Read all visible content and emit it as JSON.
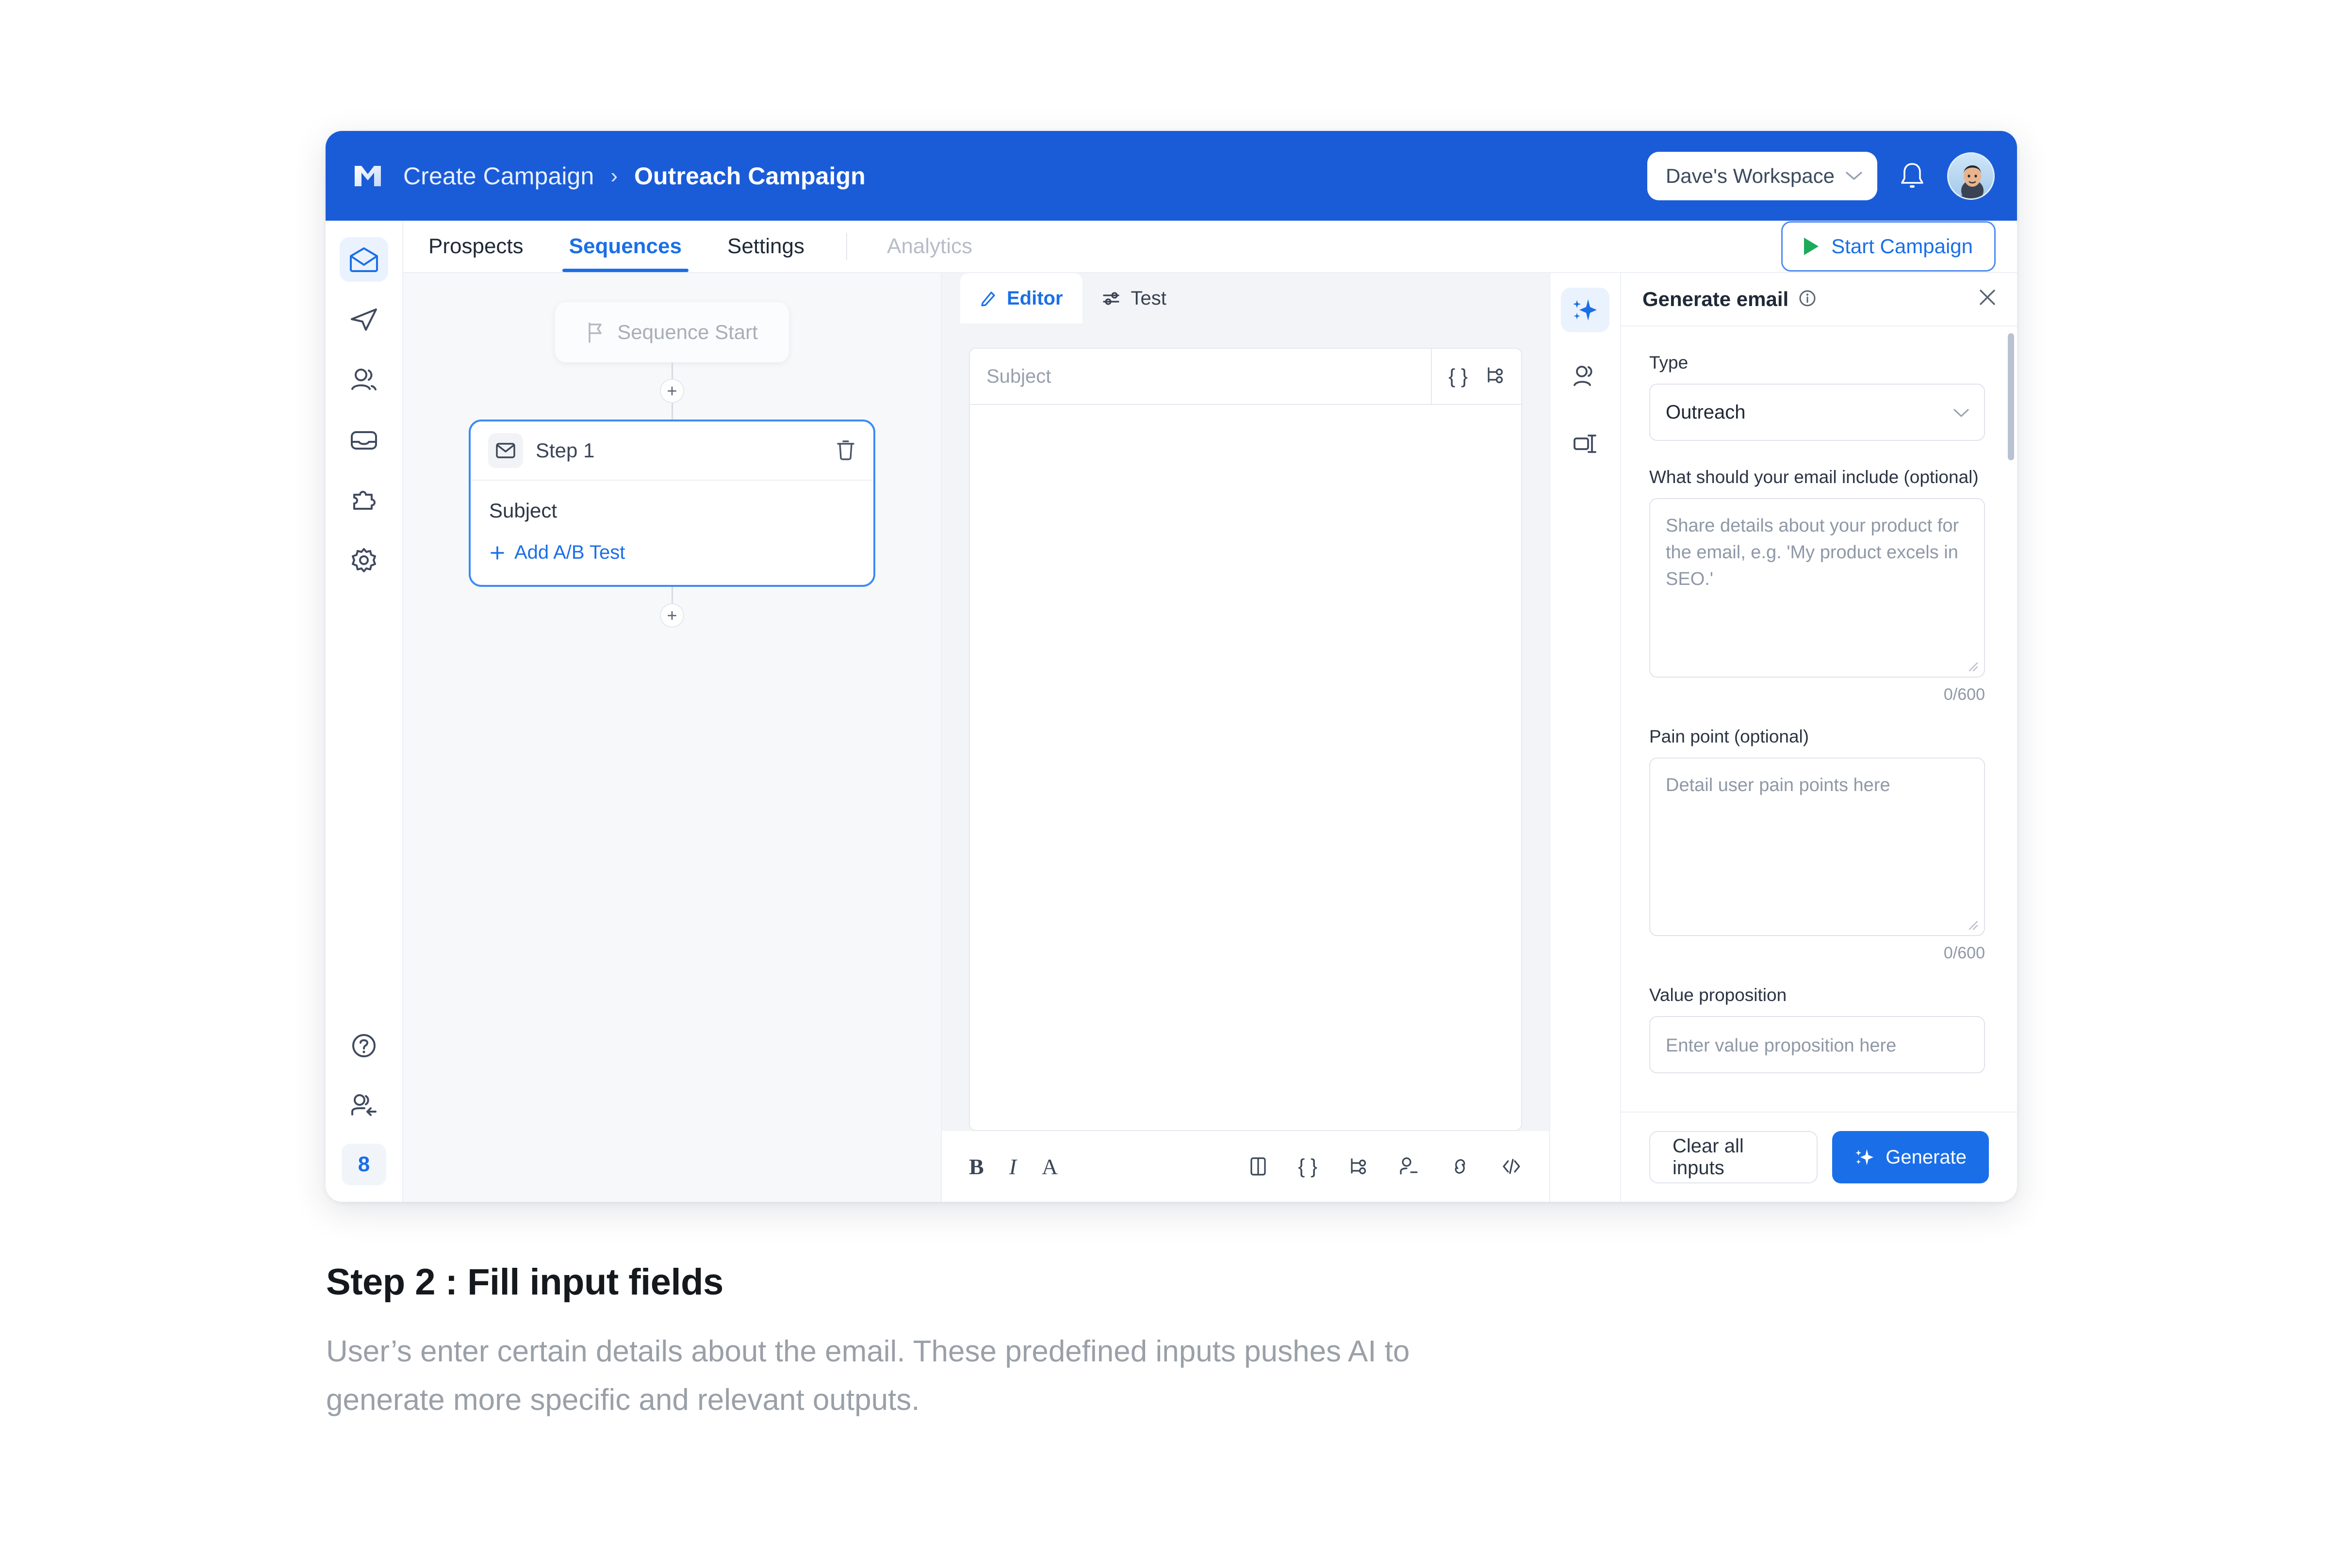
{
  "topbar": {
    "logo_icon": "logo-m-icon",
    "breadcrumb_parent": "Create Campaign",
    "breadcrumb_separator": "›",
    "breadcrumb_current": "Outreach Campaign",
    "workspace": "Dave's Workspace",
    "workspace_caret_icon": "chevron-down-icon",
    "bell_icon": "notification-bell-icon",
    "avatar_icon": "user-avatar",
    "bar_color": "#1a5cd8"
  },
  "rail": {
    "items": [
      {
        "name": "mail",
        "icon": "mail-open-icon",
        "active": true
      },
      {
        "name": "send",
        "icon": "paper-plane-icon",
        "active": false
      },
      {
        "name": "prospects",
        "icon": "people-icon",
        "active": false
      },
      {
        "name": "inbox",
        "icon": "inbox-icon",
        "active": false
      },
      {
        "name": "integrations",
        "icon": "puzzle-icon",
        "active": false
      },
      {
        "name": "settings",
        "icon": "gear-icon",
        "active": false
      }
    ],
    "bottom": [
      {
        "name": "help",
        "icon": "help-circle-icon"
      },
      {
        "name": "invite",
        "icon": "user-arrow-icon"
      }
    ],
    "badge": "8",
    "badge_color": "#1a6fe8"
  },
  "tabs": {
    "items": [
      {
        "label": "Prospects",
        "active": false,
        "disabled": false
      },
      {
        "label": "Sequences",
        "active": true,
        "disabled": false
      },
      {
        "label": "Settings",
        "active": false,
        "disabled": false
      },
      {
        "label": "Analytics",
        "active": false,
        "disabled": true
      }
    ],
    "start_button": "Start Campaign",
    "start_icon": "play-triangle-icon",
    "accent": "#1a6fe8",
    "play_color": "#1cab5b"
  },
  "canvas": {
    "sequence_start": "Sequence Start",
    "sequence_start_icon": "flag-icon",
    "step": {
      "title": "Step 1",
      "icon": "mail-closed-icon",
      "delete_icon": "trash-icon",
      "subject": "Subject",
      "ab_test": "Add A/B Test",
      "ab_icon": "plus-icon",
      "border_color": "#3d8bf2"
    },
    "add_icon": "plus-icon"
  },
  "editor": {
    "tabs": [
      {
        "label": "Editor",
        "icon": "pencil-icon",
        "active": true
      },
      {
        "label": "Test",
        "icon": "sliders-icon",
        "active": false
      }
    ],
    "subject_placeholder": "Subject",
    "subject_tools": [
      {
        "name": "variable",
        "icon": "curly-braces-icon",
        "glyph": "{ }"
      },
      {
        "name": "branch",
        "icon": "branch-icon"
      }
    ],
    "toolbar_left": [
      {
        "name": "bold",
        "icon": "bold-icon",
        "glyph": "B"
      },
      {
        "name": "italic",
        "icon": "italic-icon",
        "glyph": "I"
      },
      {
        "name": "text-style",
        "icon": "font-icon",
        "glyph": "A"
      }
    ],
    "toolbar_right": [
      {
        "name": "layout",
        "icon": "columns-icon"
      },
      {
        "name": "variable",
        "icon": "curly-braces-icon",
        "glyph": "{ }"
      },
      {
        "name": "branch",
        "icon": "branch-icon"
      },
      {
        "name": "unsubscribe",
        "icon": "user-minus-icon"
      },
      {
        "name": "link",
        "icon": "link-icon"
      },
      {
        "name": "code",
        "icon": "code-icon"
      }
    ]
  },
  "ai_panel": {
    "rail": [
      {
        "name": "generate",
        "icon": "sparkle-icon",
        "active": true
      },
      {
        "name": "persona",
        "icon": "person-icon",
        "active": false
      },
      {
        "name": "template",
        "icon": "template-icon",
        "active": false
      }
    ],
    "title": "Generate email",
    "info_icon": "info-circle-icon",
    "close_icon": "close-icon",
    "fields": [
      {
        "label": "Type",
        "control": "select",
        "value": "Outreach",
        "caret_icon": "chevron-down-icon"
      },
      {
        "label": "What should your email include (optional)",
        "control": "textarea",
        "placeholder": "Share details about your product for the email, e.g. 'My product excels in SEO.'",
        "counter": "0/600"
      },
      {
        "label": "Pain point (optional)",
        "control": "textarea",
        "placeholder": "Detail user pain points here",
        "counter": "0/600"
      },
      {
        "label": "Value proposition",
        "control": "input",
        "placeholder": "Enter value proposition here"
      }
    ],
    "clear_button": "Clear all inputs",
    "generate_button": "Generate",
    "generate_icon": "sparkle-icon",
    "generate_color": "#1a6fe8"
  },
  "caption": {
    "title": "Step 2 : Fill input fields",
    "body": "User’s enter certain details about the email. These predefined inputs pushes AI to generate more specific and relevant outputs."
  }
}
